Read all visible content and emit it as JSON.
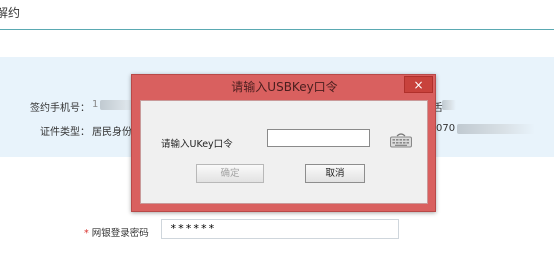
{
  "page": {
    "title": "解约"
  },
  "info": {
    "phone_label": "签约手机号：",
    "phone_value_prefix": "1",
    "idtype_label": "证件类型：",
    "idtype_value": "居民身份证",
    "right_fragment_1": "舌",
    "right_fragment_2": "070"
  },
  "password": {
    "label": "网银登录密码",
    "required_mark": "*",
    "value": "******"
  },
  "dialog": {
    "title": "请输入USBKey口令",
    "close": "×",
    "prompt_label": "请输入UKey口令",
    "input_value": "",
    "keyboard_icon": "soft-keyboard-icon",
    "ok_label": "确定",
    "cancel_label": "取消",
    "colors": {
      "frame": "#d9605f",
      "close": "#c8423c",
      "body": "#f0f0f0"
    }
  },
  "colors": {
    "info_panel": "#e8f3fb",
    "header_line": "#5aa9b2",
    "required": "#d9302c"
  }
}
